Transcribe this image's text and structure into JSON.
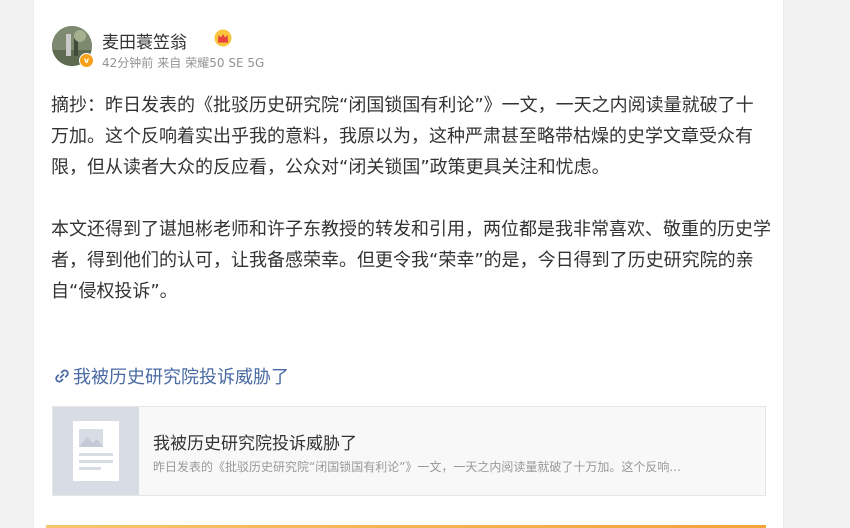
{
  "post": {
    "author": {
      "name": "麦田蓑笠翁",
      "verified_badge": "v",
      "crown_icon": "crown-icon",
      "avatar_icon": "avatar"
    },
    "meta": {
      "time": "42分钟前",
      "source_prefix": "来自",
      "source": "荣耀50 SE 5G"
    },
    "paragraphs": [
      "摘抄：昨日发表的《批驳历史研究院“闭国锁国有利论”》一文，一天之内阅读量就破了十万加。这个反响着实出乎我的意料，我原以为，这种严肃甚至略带枯燥的史学文章受众有限，但从读者大众的反应看，公众对“闭关锁国”政策更具关注和忧虑。",
      "本文还得到了谌旭彬老师和许子东教授的转发和引用，两位都是我非常喜欢、敬重的历史学者，得到他们的认可，让我备感荣幸。但更令我“荣幸”的是，今日得到了历史研究院的亲自“侵权投诉”。"
    ],
    "link": {
      "icon": "link-icon",
      "text": "我被历史研究院投诉威胁了"
    },
    "article_card": {
      "thumb_icon": "document-image-icon",
      "title": "我被历史研究院投诉威胁了",
      "description": "昨日发表的《批驳历史研究院“闭国锁国有利论”》一文，一天之内阅读量就破了十万加。这个反响..."
    },
    "colors": {
      "link": "#4a6aa4",
      "text": "#333333",
      "meta": "#939393",
      "accent": "#f3a33b"
    }
  }
}
